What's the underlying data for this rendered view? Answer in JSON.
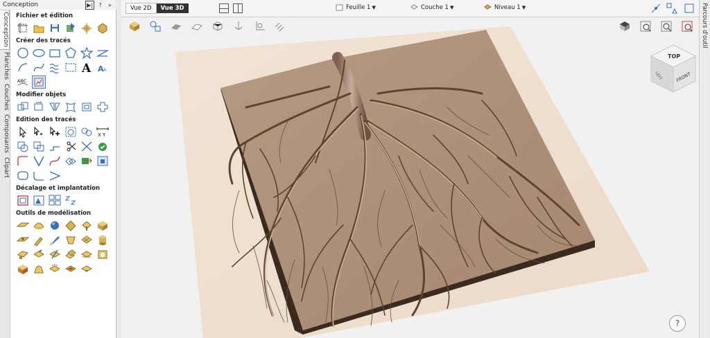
{
  "panel": {
    "title": "Conception",
    "pin_label": "▶|",
    "help_label": "?",
    "close_label": "»"
  },
  "side_tabs": [
    "Conception",
    "Planches",
    "Couches",
    "Composants",
    "Clipart"
  ],
  "sections": [
    {
      "title": "Fichier et édition",
      "icons": [
        "new-job-icon",
        "open-file-icon",
        "save-file-icon",
        "import-icon",
        "job-setup-icon",
        "settings-icon"
      ]
    },
    {
      "title": "Créer des tracés",
      "icons": [
        "circle-icon",
        "ellipse-icon",
        "rectangle-icon",
        "polygon-icon",
        "star-icon",
        "line-icon",
        "arc-icon",
        "curve-icon",
        "wave-icon",
        "selection-icon",
        "text-icon",
        "text-on-curve-icon",
        "text-arc-icon",
        "image-trace-icon"
      ]
    },
    {
      "title": "Modifier objets",
      "icons": [
        "scale-icon",
        "rotate-icon",
        "mirror-icon",
        "distort-icon",
        "inflate-icon",
        "nest-icon"
      ]
    },
    {
      "title": "Edition des tracés",
      "icons": [
        "select-icon",
        "node-edit-icon",
        "add-node-icon",
        "transform-icon",
        "weld-icon",
        "dimension-icon",
        "subtract-icon",
        "intersect-icon",
        "join-icon",
        "trim-icon",
        "cut-icon",
        "check-icon",
        "fillet-icon",
        "offset-chevron-icon",
        "curve-fit-icon",
        "array-icon",
        "align-icon",
        "bitmap-icon",
        "rounded-rect-icon",
        "bend-icon",
        "angle-icon"
      ]
    },
    {
      "title": "Décalage et implantation",
      "icons": [
        "offset-icon",
        "nesting-icon",
        "layout-icon",
        "pattern-icon"
      ]
    },
    {
      "title": "Outils de modélisation",
      "icons": [
        "model-plane-icon",
        "model-dome-icon",
        "model-sphere-icon",
        "model-spin-icon",
        "model-extrude-icon",
        "model-box-icon",
        "model-relief-icon",
        "model-sculpt-icon",
        "model-brush-icon",
        "model-smooth-icon",
        "model-mesh-icon",
        "model-cylinder-icon",
        "model-texture-icon",
        "model-smudge-icon",
        "model-slice-icon",
        "model-merge-icon",
        "model-fade-icon",
        "model-erase-icon",
        "model-freeze-icon",
        "model-scale-icon",
        "model-shear-icon",
        "model-bake-icon",
        "model-import-icon"
      ]
    }
  ],
  "top": {
    "tab_2d": "Vue 2D",
    "tab_3d": "Vue 3D",
    "sheet": "Feuille 1",
    "layer": "Couche 1",
    "level": "Niveau 1"
  },
  "cube": {
    "top": "TOP",
    "front": "FRONT",
    "left": "LEFT"
  },
  "right_strip_label": "Parcours d'outil",
  "help_label": "?",
  "colors": {
    "relief": "#a88a73",
    "relief_dark": "#5e4330",
    "board": "#f2e6d8",
    "accent": "#5b7db8"
  }
}
